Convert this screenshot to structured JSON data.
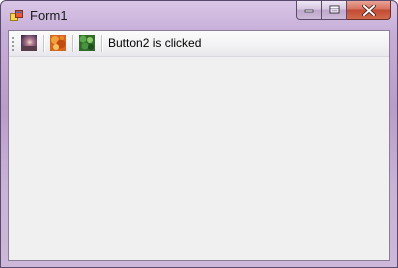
{
  "window": {
    "title": "Form1",
    "app_icon": "windows-form-icon",
    "caption_buttons": [
      {
        "name": "minimize",
        "icon": "minimize-icon"
      },
      {
        "name": "maximize",
        "icon": "maximize-icon"
      },
      {
        "name": "close",
        "icon": "close-icon"
      }
    ]
  },
  "toolstrip": {
    "buttons": [
      {
        "name": "button1",
        "icon": "image-icon-purple"
      },
      {
        "name": "button2",
        "icon": "image-icon-orange"
      },
      {
        "name": "button3",
        "icon": "image-icon-green"
      }
    ],
    "label": "Button2 is clicked"
  },
  "colors": {
    "client_background": "#f0f0f0",
    "close_button": "#c24a32",
    "frame": "#c7aed8"
  }
}
